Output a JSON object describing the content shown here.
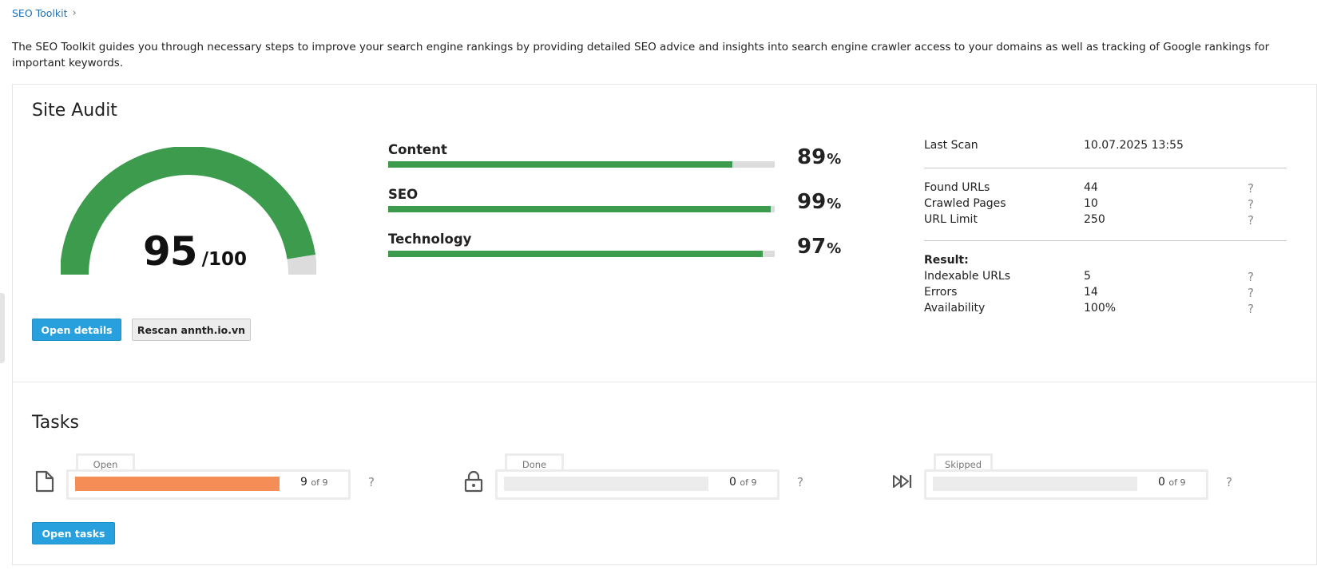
{
  "breadcrumb": {
    "root": "SEO Toolkit"
  },
  "intro": "The SEO Toolkit guides you through necessary steps to improve your search engine rankings by providing detailed SEO advice and insights into search engine crawler access to your domains as well as tracking of Google rankings for important keywords.",
  "colors": {
    "accent": "#27a0dd",
    "good": "#3d9b4d",
    "track": "#dcdcdc",
    "open_task": "#f58d57"
  },
  "site_audit": {
    "title": "Site Audit",
    "score": {
      "value": "95",
      "max": "/100",
      "fraction": 0.95
    },
    "categories": [
      {
        "label": "Content",
        "value": "89",
        "unit": "%",
        "fraction": 0.89
      },
      {
        "label": "SEO",
        "value": "99",
        "unit": "%",
        "fraction": 0.99
      },
      {
        "label": "Technology",
        "value": "97",
        "unit": "%",
        "fraction": 0.97
      }
    ],
    "last_scan": {
      "label": "Last Scan",
      "value": "10.07.2025 13:55"
    },
    "crawl": [
      {
        "label": "Found URLs",
        "value": "44",
        "help": "?"
      },
      {
        "label": "Crawled Pages",
        "value": "10",
        "help": "?"
      },
      {
        "label": "URL Limit",
        "value": "250",
        "help": "?"
      }
    ],
    "result_heading": "Result:",
    "results": [
      {
        "label": "Indexable URLs",
        "value": "5",
        "help": "?"
      },
      {
        "label": "Errors",
        "value": "14",
        "help": "?"
      },
      {
        "label": "Availability",
        "value": "100%",
        "help": "?"
      }
    ],
    "buttons": {
      "open_details": "Open details",
      "rescan": "Rescan annth.io.vn"
    }
  },
  "tasks": {
    "title": "Tasks",
    "groups": [
      {
        "label": "Open",
        "count": "9",
        "of": "of 9",
        "fraction": 1.0,
        "icon": "document-icon",
        "help": "?"
      },
      {
        "label": "Done",
        "count": "0",
        "of": "of 9",
        "fraction": 0.0,
        "icon": "lock-icon",
        "help": "?"
      },
      {
        "label": "Skipped",
        "count": "0",
        "of": "of 9",
        "fraction": 0.0,
        "icon": "skip-forward-icon",
        "help": "?"
      }
    ],
    "open_tasks_button": "Open tasks"
  }
}
